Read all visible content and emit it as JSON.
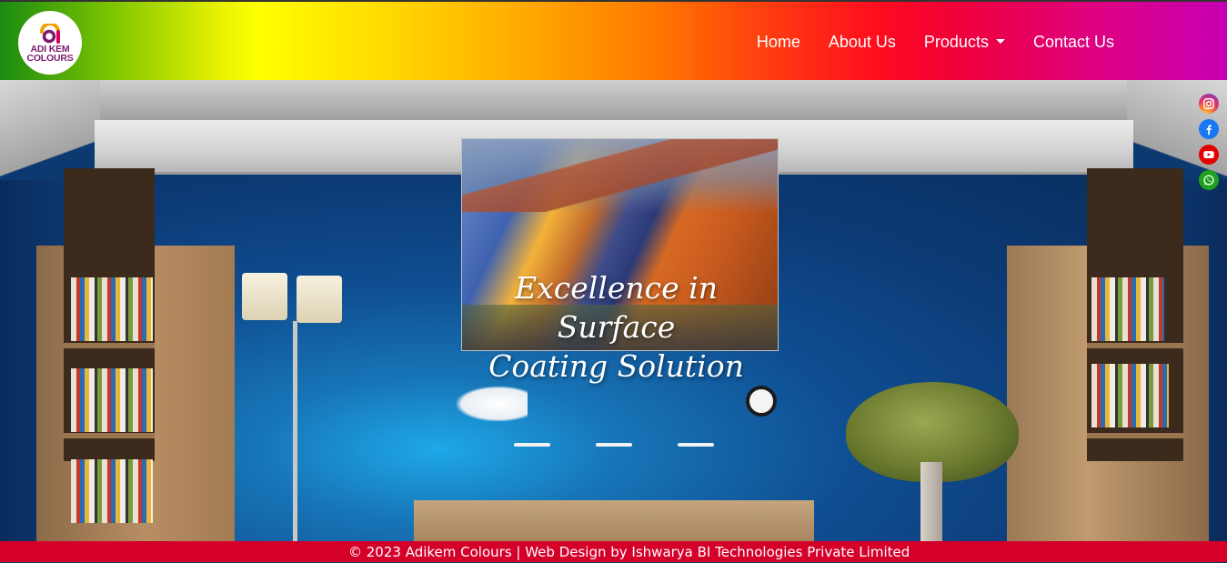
{
  "header": {
    "logo": {
      "line1": "ADI KEM",
      "line2": "COLOURS",
      "icon": "adikem-logo-icon"
    },
    "nav": [
      {
        "label": "Home"
      },
      {
        "label": "About Us"
      },
      {
        "label": "Products",
        "has_dropdown": true
      },
      {
        "label": "Contact Us"
      }
    ]
  },
  "hero": {
    "title_line1": "Excellence in Surface",
    "title_line2": "Coating Solution"
  },
  "social": [
    {
      "name": "instagram-icon",
      "color": "#e1306c"
    },
    {
      "name": "facebook-icon",
      "color": "#1877f2"
    },
    {
      "name": "youtube-icon",
      "color": "#e40000"
    },
    {
      "name": "whatsapp-icon",
      "color": "#1fa11f"
    }
  ],
  "footer": {
    "text": "© 2023 Adikem Colours | Web Design by Ishwarya BI Technologies Private Limited"
  },
  "colors": {
    "footer_bg": "#d5002a",
    "nav_text": "#ffffff"
  }
}
